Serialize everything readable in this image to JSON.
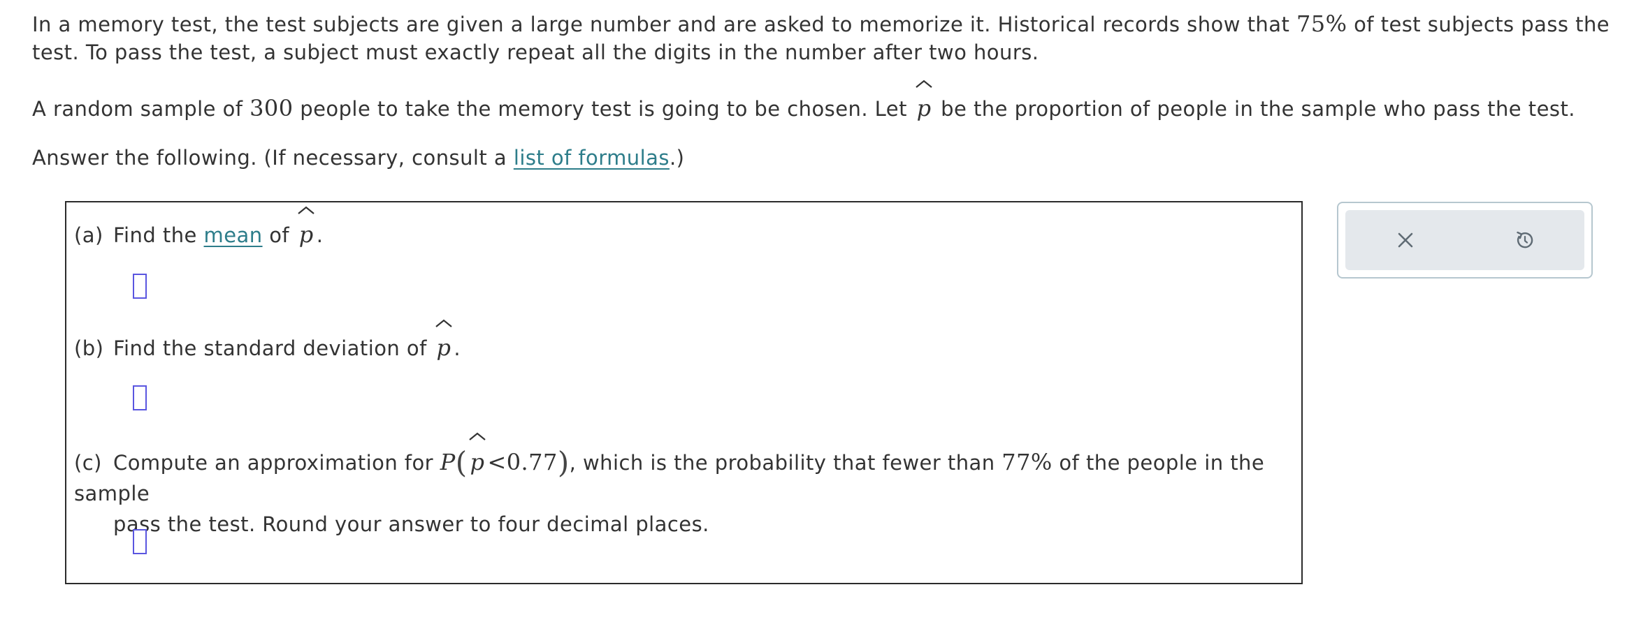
{
  "intro": {
    "p1_a": "In a memory test, the test subjects are given a large number and are asked to memorize it. Historical records show that ",
    "p1_pct": "75%",
    "p1_b": " of test subjects pass the test. To pass the test, a subject must exactly repeat all the digits in the number after two hours.",
    "p2_a": "A random sample of ",
    "p2_n": "300",
    "p2_b": " people to take the memory test is going to be chosen. Let ",
    "p2_var": "p",
    "p2_c": " be the proportion of people in the sample who pass the test.",
    "p3_a": "Answer the following. (If necessary, consult a ",
    "p3_link": "list of formulas",
    "p3_b": ".)"
  },
  "questions": {
    "a": {
      "tag": "(a)",
      "text_a": "Find the ",
      "link": "mean",
      "text_b": " of ",
      "var": "p",
      "end": ".",
      "answer": ""
    },
    "b": {
      "tag": "(b)",
      "text_a": "Find the standard deviation of ",
      "var": "p",
      "end": ".",
      "answer": ""
    },
    "c": {
      "tag": "(c)",
      "text_a": "Compute an approximation for ",
      "P": "P",
      "lparen": "(",
      "var": "p",
      "lt": "<",
      "val": "0.77",
      "rparen": ")",
      "text_b": ", which is the probability that fewer than ",
      "pct": "77%",
      "text_c": " of the people in the sample",
      "line2": "pass the test. Round your answer to four decimal places.",
      "answer": ""
    }
  },
  "tools": {
    "clear_icon": "close-x-icon",
    "reset_icon": "undo-reset-icon",
    "icon_color": "#5f6b74"
  },
  "colors": {
    "link": "#2d7d8a",
    "answer_box_border": "#5a56e0",
    "tool_bg": "#e4e8ec",
    "tool_border": "#b6c7cf"
  }
}
